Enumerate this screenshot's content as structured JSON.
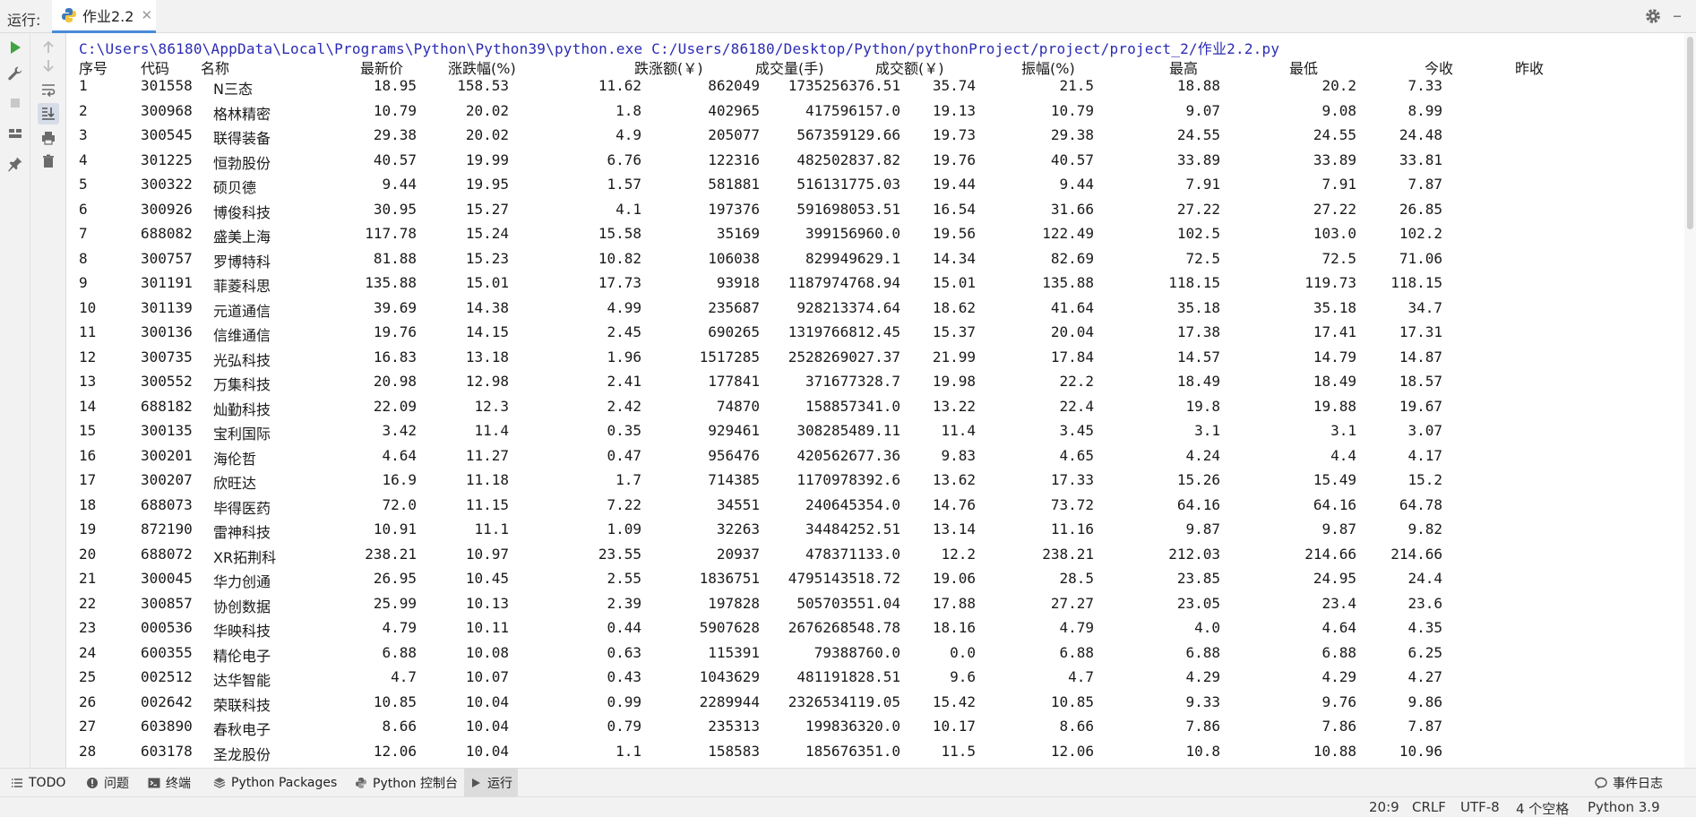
{
  "toolbar": {
    "run_label": "运行:",
    "tab_title": "作业2.2"
  },
  "console": {
    "command": "C:\\Users\\86180\\AppData\\Local\\Programs\\Python\\Python39\\python.exe C:/Users/86180/Desktop/Python/pythonProject/project/project_2/作业2.2.py",
    "headers": [
      "序号",
      "代码",
      "名称",
      "最新价",
      "涨跌幅(%)",
      "跌涨额(￥)",
      "成交量(手)",
      "成交额(￥)",
      "振幅(%)",
      "最高",
      "最低",
      "今收",
      "昨收"
    ],
    "rows": [
      [
        "1",
        "301558",
        "N三态",
        "18.95",
        "158.53",
        "11.62",
        "862049",
        "1735256376.51",
        "35.74",
        "21.5",
        "18.88",
        "20.2",
        "7.33"
      ],
      [
        "2",
        "300968",
        "格林精密",
        "10.79",
        "20.02",
        "1.8",
        "402965",
        "417596157.0",
        "19.13",
        "10.79",
        "9.07",
        "9.08",
        "8.99"
      ],
      [
        "3",
        "300545",
        "联得装备",
        "29.38",
        "20.02",
        "4.9",
        "205077",
        "567359129.66",
        "19.73",
        "29.38",
        "24.55",
        "24.55",
        "24.48"
      ],
      [
        "4",
        "301225",
        "恒勃股份",
        "40.57",
        "19.99",
        "6.76",
        "122316",
        "482502837.82",
        "19.76",
        "40.57",
        "33.89",
        "33.89",
        "33.81"
      ],
      [
        "5",
        "300322",
        "硕贝德",
        "9.44",
        "19.95",
        "1.57",
        "581881",
        "516131775.03",
        "19.44",
        "9.44",
        "7.91",
        "7.91",
        "7.87"
      ],
      [
        "6",
        "300926",
        "博俊科技",
        "30.95",
        "15.27",
        "4.1",
        "197376",
        "591698053.51",
        "16.54",
        "31.66",
        "27.22",
        "27.22",
        "26.85"
      ],
      [
        "7",
        "688082",
        "盛美上海",
        "117.78",
        "15.24",
        "15.58",
        "35169",
        "399156960.0",
        "19.56",
        "122.49",
        "102.5",
        "103.0",
        "102.2"
      ],
      [
        "8",
        "300757",
        "罗博特科",
        "81.88",
        "15.23",
        "10.82",
        "106038",
        "829949629.1",
        "14.34",
        "82.69",
        "72.5",
        "72.5",
        "71.06"
      ],
      [
        "9",
        "301191",
        "菲菱科思",
        "135.88",
        "15.01",
        "17.73",
        "93918",
        "1187974768.94",
        "15.01",
        "135.88",
        "118.15",
        "119.73",
        "118.15"
      ],
      [
        "10",
        "301139",
        "元道通信",
        "39.69",
        "14.38",
        "4.99",
        "235687",
        "928213374.64",
        "18.62",
        "41.64",
        "35.18",
        "35.18",
        "34.7"
      ],
      [
        "11",
        "300136",
        "信维通信",
        "19.76",
        "14.15",
        "2.45",
        "690265",
        "1319766812.45",
        "15.37",
        "20.04",
        "17.38",
        "17.41",
        "17.31"
      ],
      [
        "12",
        "300735",
        "光弘科技",
        "16.83",
        "13.18",
        "1.96",
        "1517285",
        "2528269027.37",
        "21.99",
        "17.84",
        "14.57",
        "14.79",
        "14.87"
      ],
      [
        "13",
        "300552",
        "万集科技",
        "20.98",
        "12.98",
        "2.41",
        "177841",
        "371677328.7",
        "19.98",
        "22.2",
        "18.49",
        "18.49",
        "18.57"
      ],
      [
        "14",
        "688182",
        "灿勤科技",
        "22.09",
        "12.3",
        "2.42",
        "74870",
        "158857341.0",
        "13.22",
        "22.4",
        "19.8",
        "19.88",
        "19.67"
      ],
      [
        "15",
        "300135",
        "宝利国际",
        "3.42",
        "11.4",
        "0.35",
        "929461",
        "308285489.11",
        "11.4",
        "3.45",
        "3.1",
        "3.1",
        "3.07"
      ],
      [
        "16",
        "300201",
        "海伦哲",
        "4.64",
        "11.27",
        "0.47",
        "956476",
        "420562677.36",
        "9.83",
        "4.65",
        "4.24",
        "4.4",
        "4.17"
      ],
      [
        "17",
        "300207",
        "欣旺达",
        "16.9",
        "11.18",
        "1.7",
        "714385",
        "1170978392.6",
        "13.62",
        "17.33",
        "15.26",
        "15.49",
        "15.2"
      ],
      [
        "18",
        "688073",
        "毕得医药",
        "72.0",
        "11.15",
        "7.22",
        "34551",
        "240645354.0",
        "14.76",
        "73.72",
        "64.16",
        "64.16",
        "64.78"
      ],
      [
        "19",
        "872190",
        "雷神科技",
        "10.91",
        "11.1",
        "1.09",
        "32263",
        "34484252.51",
        "13.14",
        "11.16",
        "9.87",
        "9.87",
        "9.82"
      ],
      [
        "20",
        "688072",
        "XR拓荆科",
        "238.21",
        "10.97",
        "23.55",
        "20937",
        "478371133.0",
        "12.2",
        "238.21",
        "212.03",
        "214.66",
        "214.66"
      ],
      [
        "21",
        "300045",
        "华力创通",
        "26.95",
        "10.45",
        "2.55",
        "1836751",
        "4795143518.72",
        "19.06",
        "28.5",
        "23.85",
        "24.95",
        "24.4"
      ],
      [
        "22",
        "300857",
        "协创数据",
        "25.99",
        "10.13",
        "2.39",
        "197828",
        "505703551.04",
        "17.88",
        "27.27",
        "23.05",
        "23.4",
        "23.6"
      ],
      [
        "23",
        "000536",
        "华映科技",
        "4.79",
        "10.11",
        "0.44",
        "5907628",
        "2676268548.78",
        "18.16",
        "4.79",
        "4.0",
        "4.64",
        "4.35"
      ],
      [
        "24",
        "600355",
        "精伦电子",
        "6.88",
        "10.08",
        "0.63",
        "115391",
        "79388760.0",
        "0.0",
        "6.88",
        "6.88",
        "6.88",
        "6.25"
      ],
      [
        "25",
        "002512",
        "达华智能",
        "4.7",
        "10.07",
        "0.43",
        "1043629",
        "481191828.51",
        "9.6",
        "4.7",
        "4.29",
        "4.29",
        "4.27"
      ],
      [
        "26",
        "002642",
        "荣联科技",
        "10.85",
        "10.04",
        "0.99",
        "2289944",
        "2326534119.05",
        "15.42",
        "10.85",
        "9.33",
        "9.76",
        "9.86"
      ],
      [
        "27",
        "603890",
        "春秋电子",
        "8.66",
        "10.04",
        "0.79",
        "235313",
        "199836320.0",
        "10.17",
        "8.66",
        "7.86",
        "7.86",
        "7.87"
      ],
      [
        "28",
        "603178",
        "圣龙股份",
        "12.06",
        "10.04",
        "1.1",
        "158583",
        "185676351.0",
        "11.5",
        "12.06",
        "10.8",
        "10.88",
        "10.96"
      ]
    ]
  },
  "bottom_tabs": [
    {
      "label": "TODO",
      "icon": "list-icon"
    },
    {
      "label": "问题",
      "icon": "info-icon"
    },
    {
      "label": "终端",
      "icon": "terminal-icon"
    },
    {
      "label": "Python Packages",
      "icon": "packages-icon"
    },
    {
      "label": "Python 控制台",
      "icon": "python-console-icon"
    },
    {
      "label": "运行",
      "icon": "run-icon"
    }
  ],
  "status": {
    "event_log": "事件日志",
    "position": "20:9",
    "line_sep": "CRLF",
    "encoding": "UTF-8",
    "indent": "4 个空格",
    "interpreter": "Python 3.9"
  },
  "colors": {
    "command": "#2b2bb3",
    "run_green": "#3fa33f",
    "tab_underline": "#4a8ad8"
  }
}
